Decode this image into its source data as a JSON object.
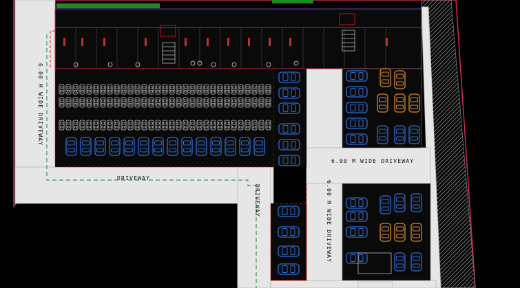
{
  "drawing": {
    "labels": {
      "left_driveway": "6.00 M WIDE DRIVEWAY",
      "center_driveway_h": "6.00 M WIDE DRIVEWAY",
      "center_driveway_v": "6.00 M WIDE DRIVEWAY",
      "bottom_driveway": "DRIVEWAY",
      "ramp_driveway": "DRIVEWAY"
    },
    "colors": {
      "background": "#000000",
      "driveway": "#e6e6e6",
      "boundary": "#d22b5a",
      "car_blue": "#2f6fd6",
      "car_orange": "#d68a2f",
      "green_strip": "#1f8a1f",
      "red_dash": "#e02020",
      "green_dash": "#1f7a3a"
    },
    "symbols": {
      "car": "car-outline-icon",
      "tree": "tree-symbol-icon",
      "stair": "staircase-icon"
    }
  }
}
